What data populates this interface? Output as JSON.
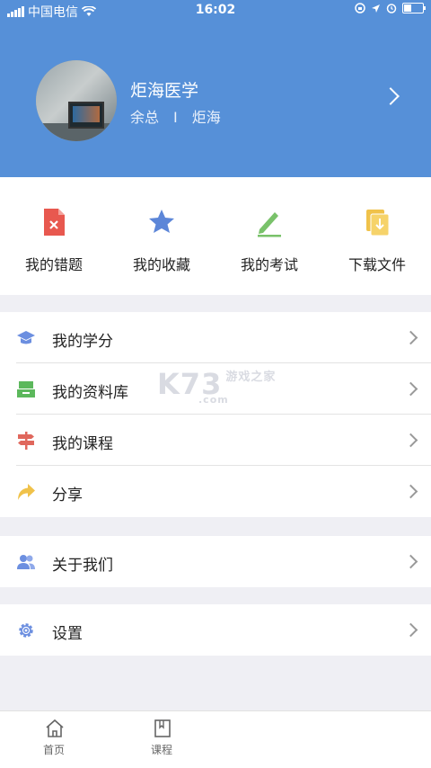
{
  "status_bar": {
    "carrier": "中国电信",
    "time": "16:02"
  },
  "profile": {
    "name": "炬海医学",
    "role": "余总",
    "separator": "I",
    "org": "炬海"
  },
  "quick_actions": [
    {
      "label": "我的错题",
      "icon": "wrong-questions-icon",
      "color": "#e8584f"
    },
    {
      "label": "我的收藏",
      "icon": "star-icon",
      "color": "#5c86d8"
    },
    {
      "label": "我的考试",
      "icon": "pen-icon",
      "color": "#79c26a"
    },
    {
      "label": "下载文件",
      "icon": "download-file-icon",
      "color": "#f0c24a"
    }
  ],
  "menu_group_1": [
    {
      "label": "我的学分",
      "icon": "graduation-cap-icon",
      "color": "#6c8fe0"
    },
    {
      "label": "我的资料库",
      "icon": "archive-icon",
      "color": "#5cb85c"
    },
    {
      "label": "我的课程",
      "icon": "signpost-icon",
      "color": "#e0675c"
    },
    {
      "label": "分享",
      "icon": "share-arrow-icon",
      "color": "#f0c24a"
    }
  ],
  "menu_group_2": [
    {
      "label": "关于我们",
      "icon": "users-icon",
      "color": "#6c8fe0"
    }
  ],
  "menu_group_3": [
    {
      "label": "设置",
      "icon": "gear-icon",
      "color": "#6c8fe0"
    }
  ],
  "watermark": {
    "main": "K73",
    "sub": "游戏之家",
    "domain": ".com"
  },
  "tabs": [
    {
      "label": "首页",
      "icon": "home-icon"
    },
    {
      "label": "课程",
      "icon": "book-icon"
    }
  ],
  "colors": {
    "header_bg": "#5690d8",
    "page_bg": "#efeff4"
  }
}
